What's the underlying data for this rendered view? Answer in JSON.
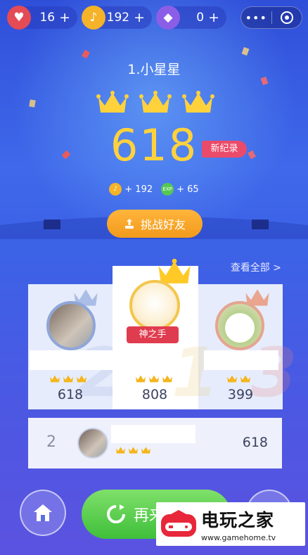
{
  "stats": {
    "hearts": {
      "icon": "heart-icon",
      "value": "16",
      "plus": "+"
    },
    "notes": {
      "icon": "music-note-icon",
      "value": "192",
      "plus": "+"
    },
    "diamonds": {
      "icon": "diamond-icon",
      "value": "0",
      "plus": "+"
    }
  },
  "capsule": {
    "more": "•••",
    "close_icon": "target-icon"
  },
  "song": {
    "title": "1.小星星",
    "crowns": 3,
    "score": "618",
    "badge": "新纪录"
  },
  "rewards": {
    "notes": "+ 192",
    "exp_icon_text": "EXP",
    "exp": "+ 65"
  },
  "challenge_button": "挑战好友",
  "view_all": "查看全部 >",
  "podium": [
    {
      "rank": "2",
      "crowns": 3,
      "score": "618",
      "title": ""
    },
    {
      "rank": "1",
      "crowns": 3,
      "score": "808",
      "title": "神之手"
    },
    {
      "rank": "3",
      "crowns": 2,
      "score": "399",
      "title": ""
    }
  ],
  "my_row": {
    "rank": "2",
    "crowns": 3,
    "score": "618"
  },
  "bottom": {
    "again_label": "再来"
  },
  "watermark": {
    "title": "电玩之家",
    "url": "www.gamehome.tv"
  },
  "colors": {
    "accent_gold": "#ffd23c",
    "badge_red": "#ea4b6a",
    "button_orange": "#f29a1c",
    "button_green": "#3fbf3a"
  }
}
